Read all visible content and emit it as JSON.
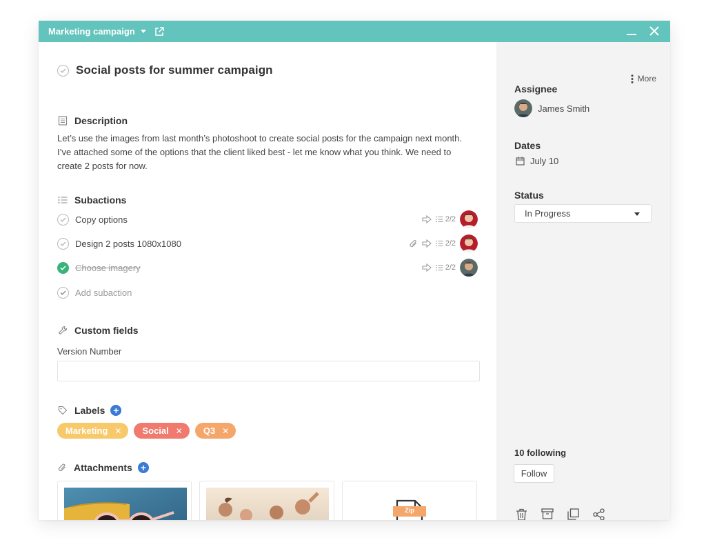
{
  "window": {
    "title": "Marketing campaign"
  },
  "task": {
    "title": "Social posts for summer campaign",
    "description_heading": "Description",
    "description": "Let’s use the images from last month’s photoshoot to create social posts for the campaign next month. I’ve attached some of the options that the client liked best - let me know what you think. We need to create 2 posts for now."
  },
  "subactions": {
    "heading": "Subactions",
    "items": [
      {
        "name": "Copy options",
        "count": "2/2",
        "done": false,
        "attachment": false
      },
      {
        "name": "Design 2 posts 1080x1080",
        "count": "2/2",
        "done": false,
        "attachment": true
      },
      {
        "name": "Choose imagery",
        "count": "2/2",
        "done": true,
        "attachment": false
      }
    ],
    "add_placeholder": "Add subaction"
  },
  "custom_fields": {
    "heading": "Custom fields",
    "field_label": "Version Number",
    "field_value": ""
  },
  "labels": {
    "heading": "Labels",
    "items": [
      {
        "name": "Marketing",
        "color": "#f7c96b"
      },
      {
        "name": "Social",
        "color": "#ef7a6d"
      },
      {
        "name": "Q3",
        "color": "#f5a66b"
      }
    ]
  },
  "attachments": {
    "heading": "Attachments",
    "zip_label": "Zip"
  },
  "sidebar": {
    "more": "More",
    "assignee_heading": "Assignee",
    "assignee_name": "James Smith",
    "dates_heading": "Dates",
    "date": "July 10",
    "status_heading": "Status",
    "status": "In Progress",
    "following": "10 following",
    "follow_button": "Follow"
  },
  "colors": {
    "titlebar": "#63c3bd",
    "accent_blue": "#3a7bd5",
    "done_green": "#39b37a",
    "zip_orange": "#f5a66b"
  }
}
